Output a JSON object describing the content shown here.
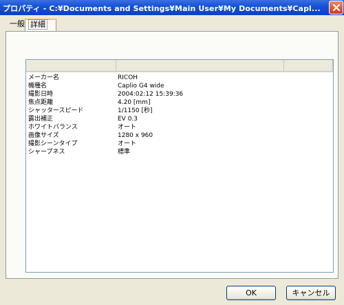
{
  "window": {
    "title": "プロパティ - C:¥Documents and Settings¥Main User¥My Documents¥Capl..."
  },
  "tabs": [
    {
      "label": "一般"
    },
    {
      "label": "詳細"
    }
  ],
  "listview": {
    "columns": [
      "",
      "",
      ""
    ],
    "rows": [
      {
        "name": "メーカー名",
        "value": "RICOH"
      },
      {
        "name": "機種名",
        "value": "Caplio G4 wide"
      },
      {
        "name": "撮影日時",
        "value": "2004:02:12 15:39:36"
      },
      {
        "name": "焦点距離",
        "value": "4.20 [mm]"
      },
      {
        "name": "シャッタースピード",
        "value": "1/1150 [秒]"
      },
      {
        "name": "露出補正",
        "value": "EV 0.3"
      },
      {
        "name": "ホワイトバランス",
        "value": "オート"
      },
      {
        "name": "画像サイズ",
        "value": "1280 x 960"
      },
      {
        "name": "撮影シーンタイプ",
        "value": "オート"
      },
      {
        "name": "シャープネス",
        "value": "標準"
      }
    ]
  },
  "buttons": {
    "ok": "OK",
    "cancel": "キャンセル"
  },
  "icons": {
    "close": "close-icon"
  },
  "colors": {
    "titlebar": "#0a3fc4",
    "close": "#d23c0c"
  }
}
